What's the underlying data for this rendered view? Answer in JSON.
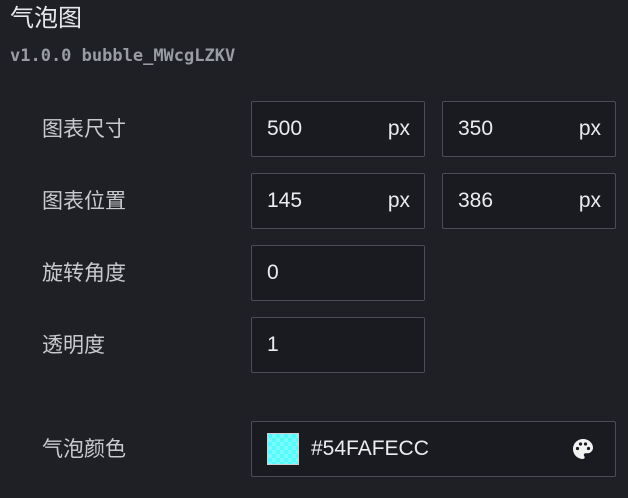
{
  "header": {
    "title": "气泡图",
    "version": "v1.0.0",
    "component_id": "bubble_MWcgLZKV"
  },
  "form": {
    "size": {
      "label": "图表尺寸",
      "width": "500",
      "height": "350",
      "unit": "px"
    },
    "position": {
      "label": "图表位置",
      "x": "145",
      "y": "386",
      "unit": "px"
    },
    "rotation": {
      "label": "旋转角度",
      "value": "0"
    },
    "opacity": {
      "label": "透明度",
      "value": "1"
    },
    "bubble_color": {
      "label": "气泡颜色",
      "value": "#54FAFECC",
      "swatch_color": "#54FAFE",
      "icon": "palette-icon"
    }
  }
}
